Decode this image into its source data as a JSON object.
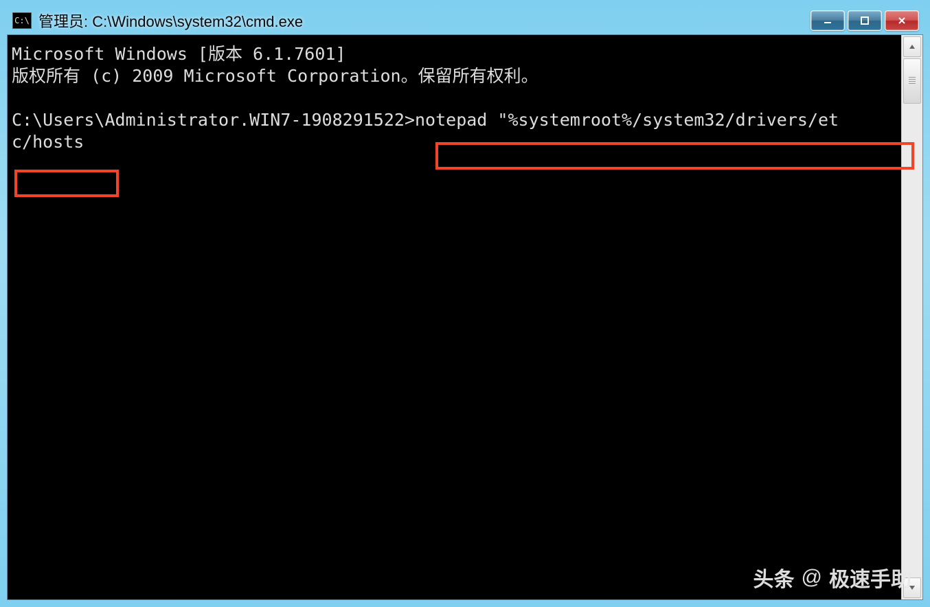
{
  "window": {
    "icon_text": "C:\\",
    "title": "管理员: C:\\Windows\\system32\\cmd.exe"
  },
  "terminal": {
    "line1": "Microsoft Windows [版本 6.1.7601]",
    "line2": "版权所有 (c) 2009 Microsoft Corporation。保留所有权利。",
    "prompt": "C:\\Users\\Administrator.WIN7-1908291522>",
    "command_part1": "notepad \"%systemroot%/system32/drivers/et",
    "command_part2": "c/hosts"
  },
  "watermark": {
    "brand": "头条",
    "at": "@",
    "name": "极速手助"
  }
}
